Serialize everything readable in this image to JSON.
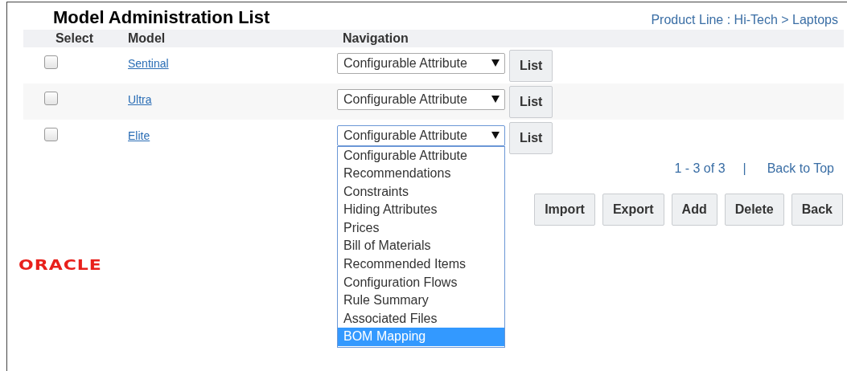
{
  "title": "Model Administration List",
  "breadcrumb": "Product Line : Hi-Tech > Laptops",
  "columns": [
    "Select",
    "Model",
    "Navigation"
  ],
  "rows": [
    {
      "checked": false,
      "model": "Sentinal",
      "navigation": "Configurable Attribute",
      "open": false,
      "button": "List"
    },
    {
      "checked": false,
      "model": "Ultra",
      "navigation": "Configurable Attribute",
      "open": false,
      "button": "List"
    },
    {
      "checked": false,
      "model": "Elite",
      "navigation": "Configurable Attribute",
      "open": true,
      "button": "List"
    }
  ],
  "dropdown_options": [
    {
      "label": "Configurable Attribute",
      "selected": false
    },
    {
      "label": "Recommendations",
      "selected": false
    },
    {
      "label": "Constraints",
      "selected": false
    },
    {
      "label": "Hiding Attributes",
      "selected": false
    },
    {
      "label": "Prices",
      "selected": false
    },
    {
      "label": "Bill of Materials",
      "selected": false
    },
    {
      "label": "Recommended Items",
      "selected": false
    },
    {
      "label": "Configuration Flows",
      "selected": false
    },
    {
      "label": "Rule Summary",
      "selected": false
    },
    {
      "label": "Associated Files",
      "selected": false
    },
    {
      "label": "BOM Mapping",
      "selected": true
    }
  ],
  "pagination": {
    "range": "1 - 3 of 3",
    "separator": "|",
    "link": "Back to Top"
  },
  "actions": [
    "Import",
    "Export",
    "Add",
    "Delete",
    "Back"
  ],
  "logo": "ORACLE"
}
